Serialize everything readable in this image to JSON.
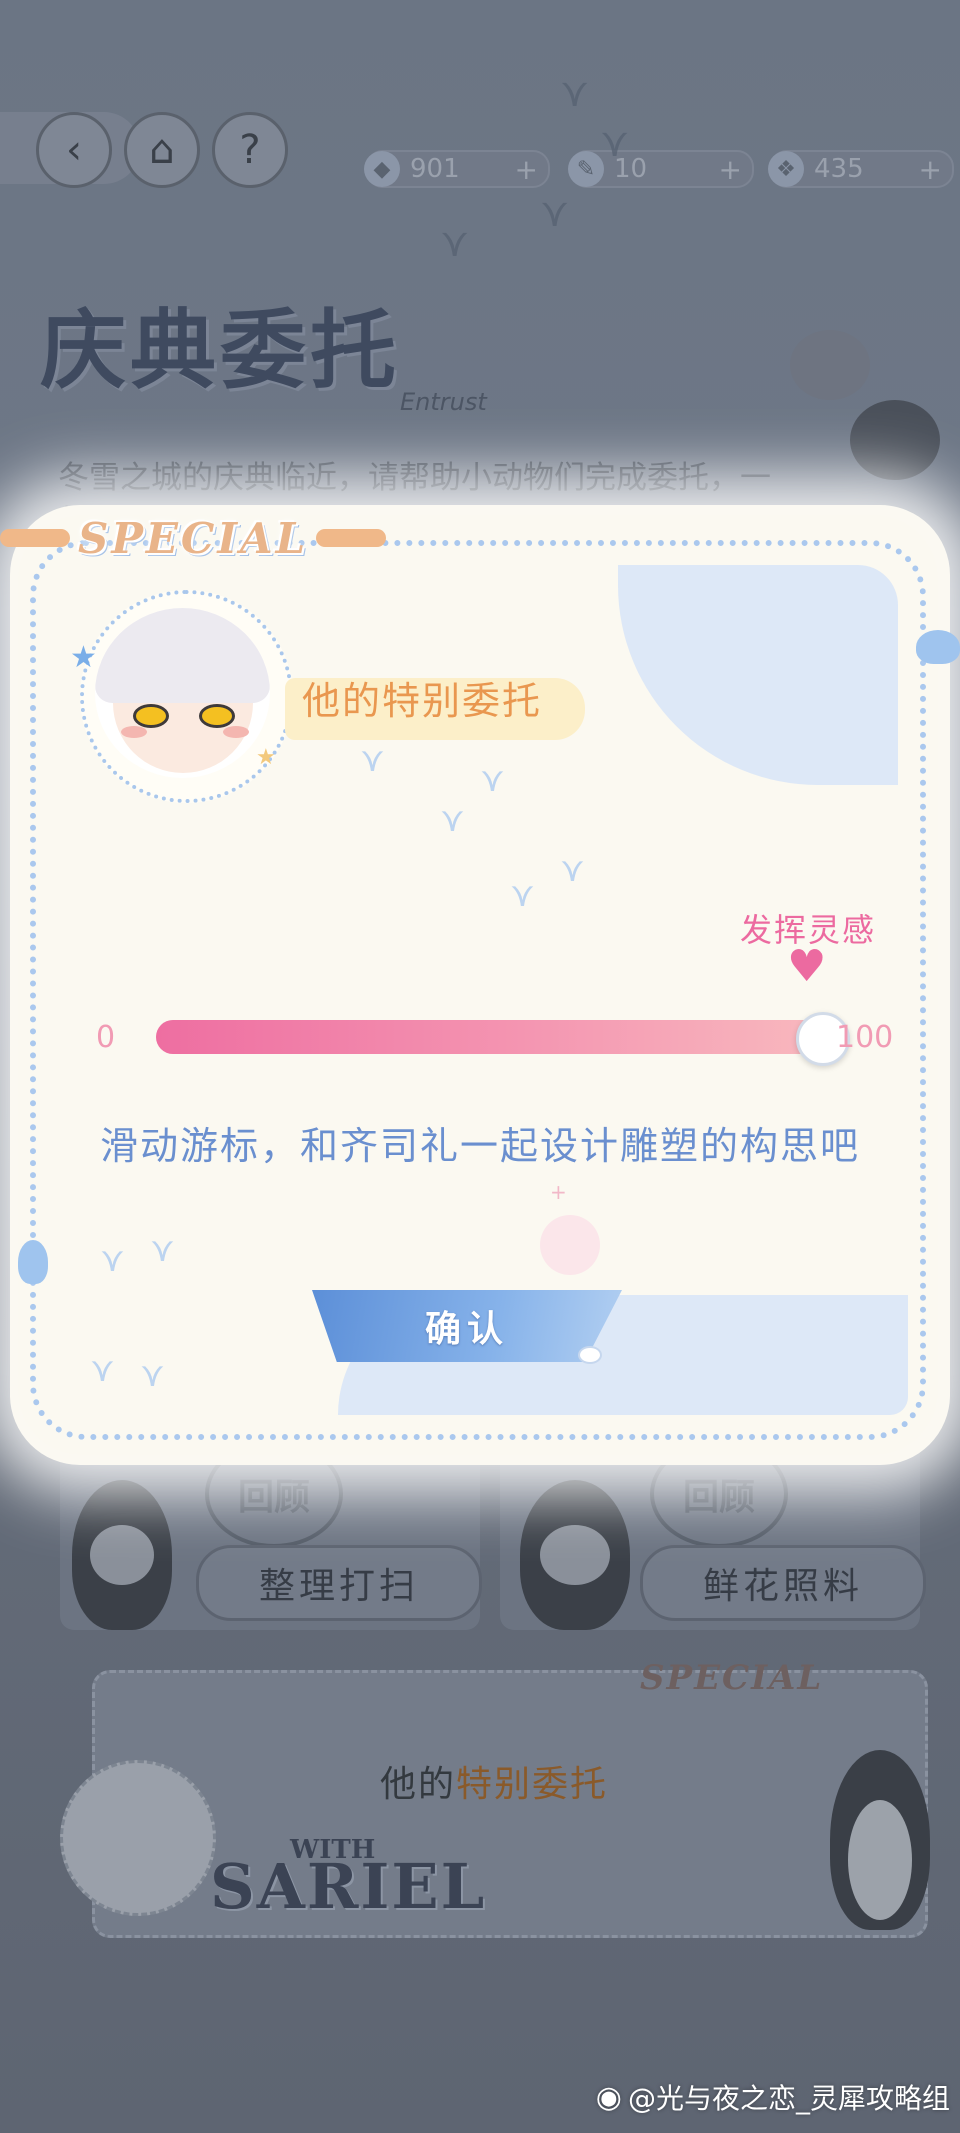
{
  "hud": {
    "back_icon": "back-arrow-icon",
    "home_icon": "home-icon",
    "help_label": "?",
    "resources": [
      {
        "icon": "sapphire-icon",
        "value": "901",
        "plus": "+"
      },
      {
        "icon": "quill-icon",
        "value": "10",
        "plus": "+"
      },
      {
        "icon": "crystal-icon",
        "value": "435",
        "plus": "+"
      }
    ]
  },
  "event": {
    "title": "庆典委托",
    "subtitle": "Entrust",
    "description": "冬雪之城的庆典临近，请帮助小动物们完成委托，一起欢度庆典吧"
  },
  "modal": {
    "special_label": "SPECIAL",
    "title": "他的特别委托",
    "inspire_label": "发挥灵感",
    "slider": {
      "min_label": "0",
      "max_label": "100",
      "value": 100,
      "min": 0,
      "max": 100
    },
    "instruction": "滑动游标，和齐司礼一起设计雕塑的构思吧",
    "confirm_label": "确认"
  },
  "tasks": [
    {
      "stamp": "回顾",
      "label": "整理打扫"
    },
    {
      "stamp": "回顾",
      "label": "鲜花照料"
    }
  ],
  "special_card": {
    "badge": "SPECIAL",
    "title_prefix": "他的",
    "title_highlight": "特别委托",
    "with_label": "WITH",
    "name": "SARIEL"
  },
  "watermark": "@光与夜之恋_灵犀攻略组",
  "colors": {
    "accent_pink": "#ec6aa0",
    "accent_blue": "#6a8fcf",
    "title_orange": "#e9974f"
  }
}
